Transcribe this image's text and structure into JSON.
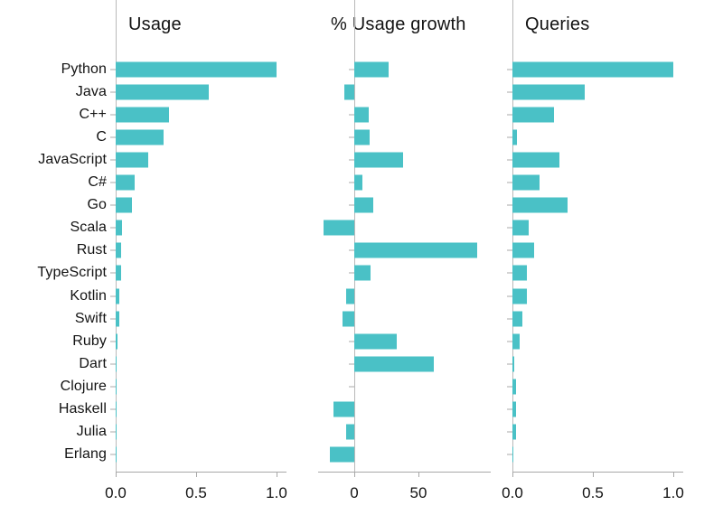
{
  "figure": {
    "bar_color": "#4ac1c6",
    "axis_color": "#a8a8a8",
    "text_color": "#131313",
    "background": "#ffffff"
  },
  "categories": [
    "Python",
    "Java",
    "C++",
    "C",
    "JavaScript",
    "C#",
    "Go",
    "Scala",
    "Rust",
    "TypeScript",
    "Kotlin",
    "Swift",
    "Ruby",
    "Dart",
    "Clojure",
    "Haskell",
    "Julia",
    "Erlang"
  ],
  "panels": [
    {
      "title": "Usage",
      "xlim": [
        0.0,
        1.06
      ],
      "ticks": [
        0.0,
        0.5,
        1.0
      ],
      "ticklabels": [
        "0.0",
        "0.5",
        "1.0"
      ],
      "values": [
        1.0,
        0.58,
        0.33,
        0.3,
        0.2,
        0.12,
        0.1,
        0.04,
        0.035,
        0.035,
        0.025,
        0.02,
        0.012,
        0.006,
        0.002,
        0.002,
        0.002,
        0.002
      ]
    },
    {
      "title": "% Usage growth",
      "xlim": [
        -28,
        106
      ],
      "ticks": [
        0,
        50
      ],
      "ticklabels": [
        "0",
        "50"
      ],
      "values": [
        27,
        -8,
        11,
        12,
        38,
        6,
        15,
        -24,
        96,
        13,
        -6,
        -9,
        33,
        62,
        0,
        -16,
        -6,
        -19
      ]
    },
    {
      "title": "Queries",
      "xlim": [
        0.0,
        1.06
      ],
      "ticks": [
        0.0,
        0.5,
        1.0
      ],
      "ticklabels": [
        "0.0",
        "0.5",
        "1.0"
      ],
      "values": [
        1.0,
        0.45,
        0.26,
        0.03,
        0.29,
        0.17,
        0.34,
        0.1,
        0.135,
        0.09,
        0.09,
        0.06,
        0.045,
        0.012,
        0.02,
        0.02,
        0.023,
        0.008
      ]
    }
  ],
  "chart_data": {
    "type": "bar",
    "title": "",
    "orientation": "horizontal",
    "subplots": 3,
    "categories": [
      "Python",
      "Java",
      "C++",
      "C",
      "JavaScript",
      "C#",
      "Go",
      "Scala",
      "Rust",
      "TypeScript",
      "Kotlin",
      "Swift",
      "Ruby",
      "Dart",
      "Clojure",
      "Haskell",
      "Julia",
      "Erlang"
    ],
    "series": [
      {
        "name": "Usage",
        "xlabel": "",
        "ylabel": "",
        "xlim": [
          0.0,
          1.06
        ],
        "xticks": [
          0.0,
          0.5,
          1.0
        ],
        "values": [
          1.0,
          0.58,
          0.33,
          0.3,
          0.2,
          0.12,
          0.1,
          0.04,
          0.035,
          0.035,
          0.025,
          0.02,
          0.012,
          0.006,
          0.002,
          0.002,
          0.002,
          0.002
        ]
      },
      {
        "name": "% Usage growth",
        "xlabel": "",
        "ylabel": "",
        "xlim": [
          -28,
          106
        ],
        "xticks": [
          0,
          50
        ],
        "values": [
          27,
          -8,
          11,
          12,
          38,
          6,
          15,
          -24,
          96,
          13,
          -6,
          -9,
          33,
          62,
          0,
          -16,
          -6,
          -19
        ]
      },
      {
        "name": "Queries",
        "xlabel": "",
        "ylabel": "",
        "xlim": [
          0.0,
          1.06
        ],
        "xticks": [
          0.0,
          0.5,
          1.0
        ],
        "values": [
          1.0,
          0.45,
          0.26,
          0.03,
          0.29,
          0.17,
          0.34,
          0.1,
          0.135,
          0.09,
          0.09,
          0.06,
          0.045,
          0.012,
          0.02,
          0.02,
          0.023,
          0.008
        ]
      }
    ],
    "grid": false,
    "legend": "none"
  }
}
